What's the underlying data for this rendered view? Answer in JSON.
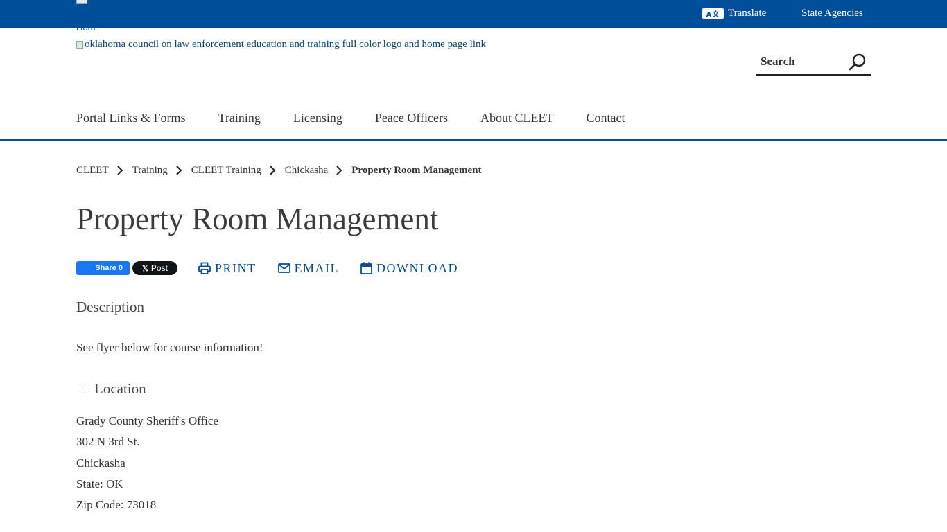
{
  "header": {
    "translate_label": "Translate",
    "translate_icon_text": "A文",
    "agencies_label": "State Agencies",
    "home_alt": "Hom",
    "logo_alt": "oklahoma council on law enforcement education and training full color logo and home page link",
    "search_placeholder": "Search"
  },
  "nav": {
    "items": [
      "Portal Links & Forms",
      "Training",
      "Licensing",
      "Peace Officers",
      "About CLEET",
      "Contact"
    ]
  },
  "breadcrumb": {
    "items": [
      "CLEET",
      "Training",
      "CLEET Training",
      "Chickasha"
    ],
    "current": "Property Room Management"
  },
  "page": {
    "title": "Property Room Management"
  },
  "share": {
    "fb_label": "Share 0",
    "x_label": "Post",
    "x_icon": "𝕏",
    "print_label": "PRINT",
    "email_label": "EMAIL",
    "download_label": "DOWNLOAD"
  },
  "description": {
    "heading": "Description",
    "text": "See flyer below for course information!"
  },
  "location": {
    "heading": "Location",
    "lines": [
      "Grady County Sheriff's Office",
      "302 N 3rd St.",
      "Chickasha",
      "State: OK",
      "Zip Code: 73018"
    ]
  },
  "colors": {
    "brand_blue": "#014e9b",
    "text": "#333333"
  }
}
